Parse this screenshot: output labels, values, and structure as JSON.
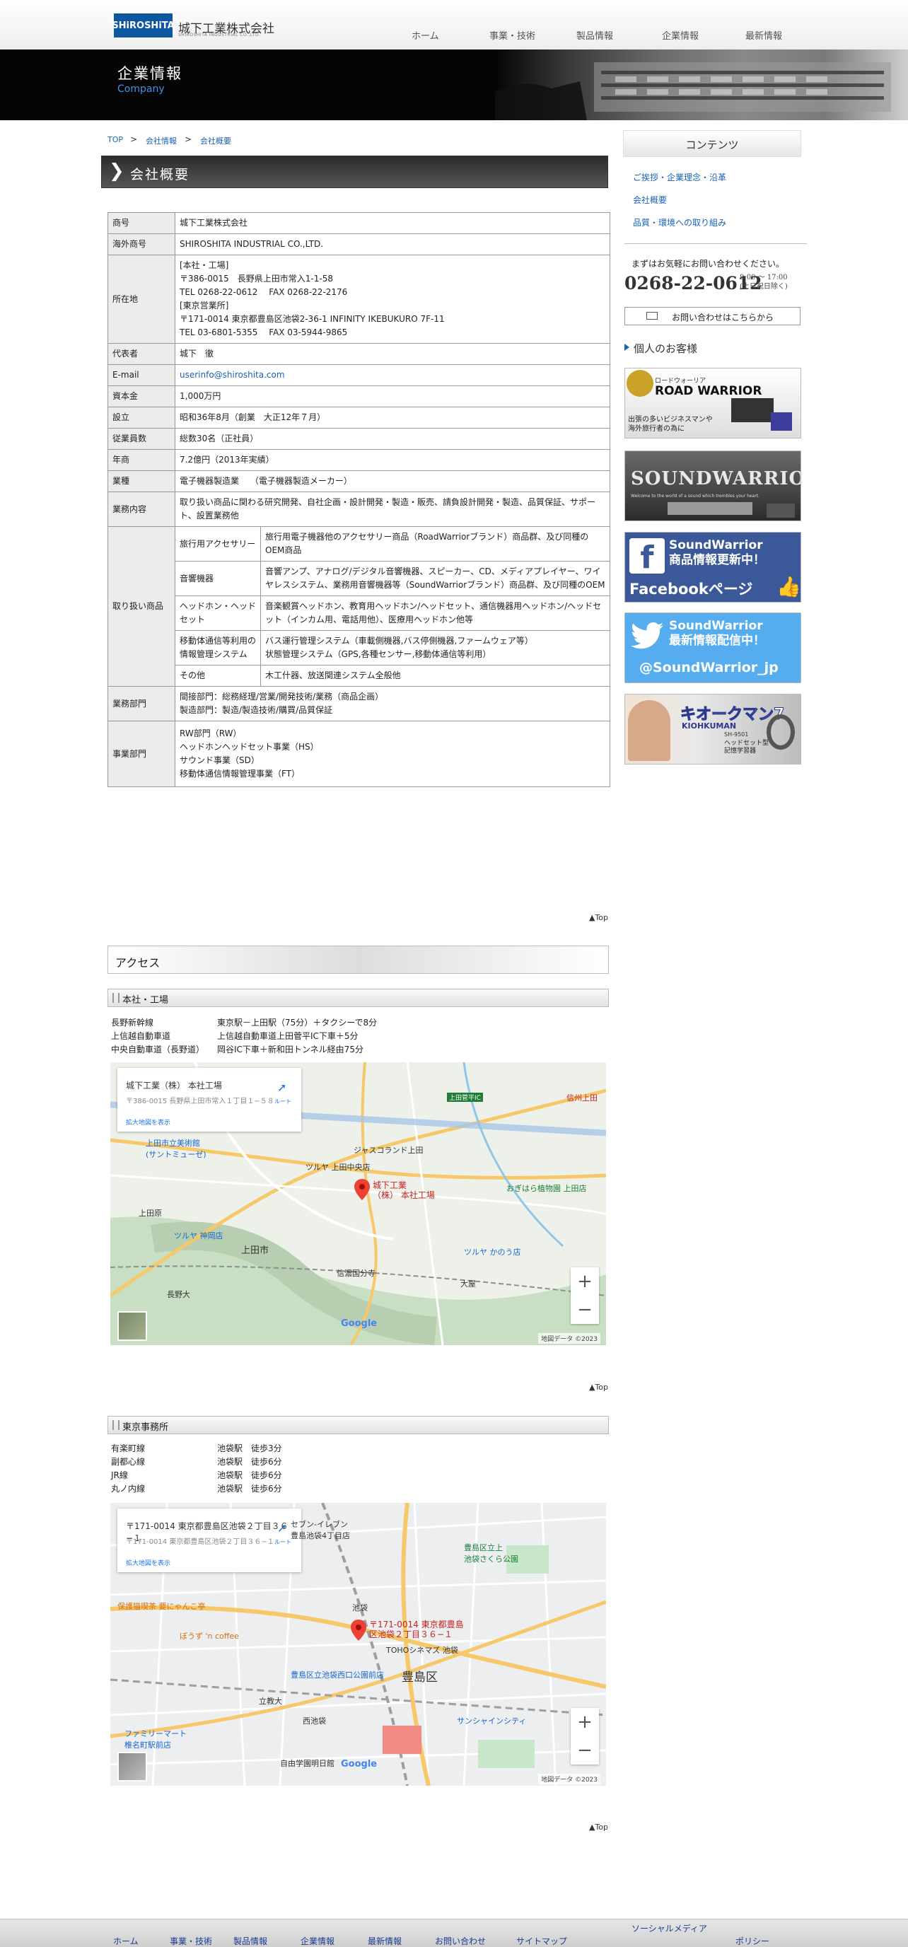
{
  "header": {
    "logo_mark": "SHiROSHiTA",
    "company_name": "城下工業株式会社",
    "company_sub": "SHIROSHITA INDUSTRIAL CO.,LTD.",
    "nav": [
      "ホーム",
      "事業・技術",
      "製品情報",
      "企業情報",
      "最新情報"
    ]
  },
  "banner": {
    "title": "企業情報",
    "subtitle": "Company"
  },
  "breadcrumb": [
    "TOP",
    "会社情報",
    "会社概要"
  ],
  "breadcrumb_sep": ">",
  "section_title": "会社概要",
  "company_table": {
    "rows": [
      {
        "label": "商号",
        "lines": [
          "城下工業株式会社"
        ]
      },
      {
        "label": "海外商号",
        "lines": [
          "SHIROSHITA INDUSTRIAL CO.,LTD."
        ]
      },
      {
        "label": "所在地",
        "lines": [
          "[本社・工場]",
          "〒386-0015　長野県上田市常入1-1-58",
          "TEL 0268-22-0612　 FAX 0268-22-2176",
          "[東京営業所]",
          "〒171-0014 東京都豊島区池袋2-36-1 INFINITY IKEBUKURO 7F-11",
          "TEL 03-6801-5355　 FAX 03-5944-9865"
        ]
      },
      {
        "label": "代表者",
        "lines": [
          "城下　徹"
        ]
      },
      {
        "label": "E-mail",
        "email": "userinfo@shiroshita.com"
      },
      {
        "label": "資本金",
        "lines": [
          "1,000万円"
        ]
      },
      {
        "label": "設立",
        "lines": [
          "昭和36年8月（創業　大正12年７月）"
        ]
      },
      {
        "label": "従業員数",
        "lines": [
          "総数30名（正社員）"
        ]
      },
      {
        "label": "年商",
        "lines": [
          "7.2億円（2013年実績）"
        ]
      },
      {
        "label": "業種",
        "lines": [
          "電子機器製造業　 （電子機器製造メーカー）"
        ]
      },
      {
        "label": "業務内容",
        "lines": [
          "取り扱い商品に関わる研究開発、自社企画・設計開発・製造・販売、請負設計開発・製造、品質保証、サポート、設置業務他"
        ]
      }
    ],
    "products_label": "取り扱い商品",
    "products": [
      {
        "name": "旅行用アクセサリー",
        "desc": "旅行用電子機器他のアクセサリー商品（RoadWarriorブランド）商品群、及び同種のOEM商品"
      },
      {
        "name": "音響機器",
        "desc": "音響アンプ、アナログ/デジタル音響機器、スピーカー、CD、メディアプレイヤー、ワイヤレスシステム、業務用音響機器等（SoundWarriorブランド）商品群、及び同種のOEM"
      },
      {
        "name": "ヘッドホン・ヘッドセット",
        "desc": "音楽観賞ヘッドホン、教育用ヘッドホン/ヘッドセット、通信機器用ヘッドホン/ヘッドセット（インカム用、電話用他）、医療用ヘッドホン他等"
      },
      {
        "name": "移動体通信等利用の情報管理システム",
        "desc": "バス運行管理システム（車載側機器,バス停側機器,ファームウェア等）\n状態管理システム（GPS,各種センサー,移動体通信等利用）"
      },
      {
        "name": "その他",
        "desc": "木工什器、放送関連システム全般他"
      }
    ],
    "dept": {
      "label": "業務部門",
      "lines": [
        "間接部門：総務経理/営業/開発技術/業務（商品企画）",
        "製造部門：製造/製造技術/購買/品質保証"
      ]
    },
    "biz": {
      "label": "事業部門",
      "lines": [
        "RW部門（RW）",
        "ヘッドホンヘッドセット事業（HS）",
        "サウンド事業（SD）",
        "移動体通信情報管理事業（FT）"
      ]
    }
  },
  "top_link": "▲Top",
  "access": {
    "title": "アクセス",
    "hq": {
      "title": "本社・工場",
      "routes": [
        {
          "line": "長野新幹線",
          "desc": "東京駅－上田駅（75分）＋タクシーで8分"
        },
        {
          "line": "上信越自動車道",
          "desc": "上信越自動車道上田菅平IC下車＋5分"
        },
        {
          "line": "中央自動車道（長野道）",
          "desc": "岡谷IC下車＋新和田トンネル経由75分"
        }
      ],
      "map": {
        "card_title": "城下工業（株） 本社工場",
        "card_addr": "〒386-0015 長野県上田市常入１丁目１−５８",
        "card_link": "拡大地図を表示",
        "card_dir": "ルート",
        "pin_label": "城下工業\n（株） 本社工場",
        "places": [
          "上田市立美術館\n(サントミューゼ)",
          "ツルヤ 上田中央店",
          "ジャスコランド上田",
          "おぎはら植物園 上田店",
          "上田市",
          "ツルヤ 神岡店",
          "上田原",
          "信濃国分寺",
          "長野大",
          "ツルヤ かのう店",
          "大屋",
          "上田菅平IC",
          "信州上田"
        ],
        "google": "Google",
        "copyright": "地図データ ©2023"
      }
    },
    "tokyo": {
      "title": "東京事務所",
      "routes": [
        {
          "line": "有楽町線",
          "desc": "池袋駅　徒歩3分"
        },
        {
          "line": "副都心線",
          "desc": "池袋駅　徒歩6分"
        },
        {
          "line": "JR線",
          "desc": "池袋駅　徒歩6分"
        },
        {
          "line": "丸ノ内線",
          "desc": "池袋駅　徒歩6分"
        }
      ],
      "map": {
        "card_title": "〒171-0014 東京都豊島区池袋２丁目３６−１",
        "card_addr": "〒171-0014 東京都豊島区池袋２丁目３６−１",
        "card_link": "拡大地図を表示",
        "card_dir": "ルート",
        "pin_label": "〒171-0014 東京都豊島\n区池袋２丁目３６−１",
        "places": [
          "豊島区",
          "池袋",
          "セブン-イレブン\n豊島池袋4丁目店",
          "豊島区立上\n池袋さくら公園",
          "TOHOシネマズ 池袋",
          "サンシャインシティ",
          "西池袋",
          "立教大",
          "保護猫喫茶 要にゃんこ亭",
          "ぼうず 'n coffee",
          "ファミリーマート\n椎名町駅前店",
          "豊島区立池袋西口公園前店",
          "自由学園明日館"
        ],
        "google": "Google",
        "copyright": "地図データ ©2023"
      }
    }
  },
  "sidebar": {
    "heading": "コンテンツ",
    "links": [
      "ご挨拶・企業理念・沿革",
      "会社概要",
      "品質・環境への取り組み"
    ],
    "contact_intro": "まずはお気軽にお問い合わせください。",
    "phone": "0268-22-0612",
    "hours": "9:00 ～ 17:00\n(土日祝日除く)",
    "contact_button": "お問い合わせはこちらから",
    "personal_heading": "個人のお客様",
    "ads": [
      {
        "title": "ROAD WARRIOR",
        "caption": "出張の多いビジネスマンや\n海外旅行者の為に",
        "tag": "ロードウォーリア"
      },
      {
        "title": "SOUNDWARRIOR",
        "caption": "Welcome to the world of a sound which trembles your heart."
      },
      {
        "title": "SoundWarrior\n商品情報更新中！",
        "caption": "Facebookページ"
      },
      {
        "title": "SoundWarrior\n最新情報配信中！",
        "caption": "@SoundWarrior_jp"
      },
      {
        "title": "キオークマン7",
        "caption": "ヘッドセット型\n記憶学習器",
        "model": "SH-9501",
        "tag": "KIOHKUMAN"
      }
    ]
  },
  "footer": {
    "links": [
      "ホーム",
      "事業・技術",
      "製品情報",
      "企業情報",
      "最新情報",
      "お問い合わせ",
      "サイトマップ",
      "ソーシャルメディア",
      "ポリシー"
    ]
  },
  "colors": {
    "brand_blue": "#0d56a0",
    "link": "#1a62b3",
    "facebook": "#3b5998",
    "twitter": "#55acee"
  }
}
